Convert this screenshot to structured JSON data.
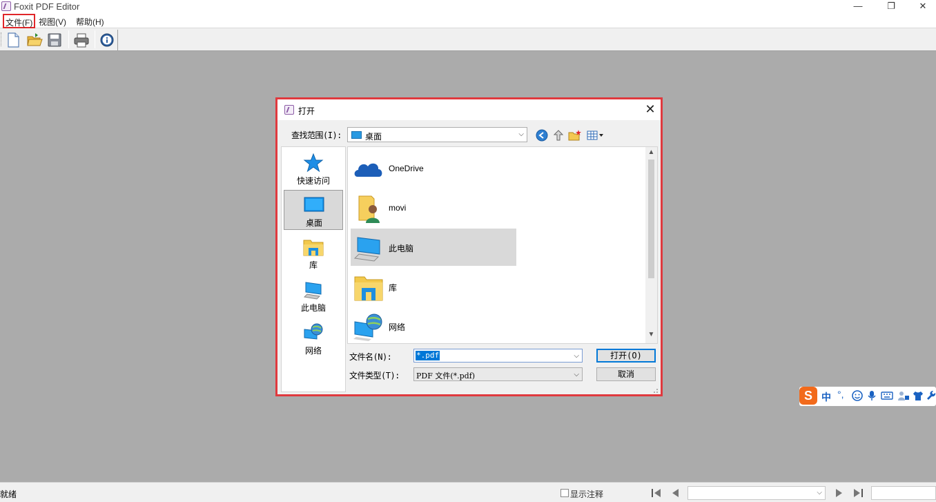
{
  "app": {
    "title": "Foxit PDF Editor",
    "window_buttons": {
      "minimize": "—",
      "restore": "❐",
      "close": "✕"
    }
  },
  "menubar": {
    "items": [
      {
        "label": "文件(F)"
      },
      {
        "label": "视图(V)"
      },
      {
        "label": "帮助(H)"
      }
    ]
  },
  "toolbar": {
    "buttons": [
      "new-document-icon",
      "open-folder-icon",
      "save-icon",
      "print-icon",
      "info-icon"
    ]
  },
  "dialog": {
    "title": "打开",
    "close": "✕",
    "look_in_label": "查找范围(I):",
    "look_in_value": "桌面",
    "places": [
      {
        "label": "快速访问",
        "icon": "quick-access-star-icon"
      },
      {
        "label": "桌面",
        "icon": "desktop-icon",
        "selected": true
      },
      {
        "label": "库",
        "icon": "library-icon"
      },
      {
        "label": "此电脑",
        "icon": "this-pc-icon"
      },
      {
        "label": "网络",
        "icon": "network-icon"
      }
    ],
    "files": [
      {
        "name": "OneDrive",
        "icon": "onedrive-cloud-icon"
      },
      {
        "name": "movi",
        "icon": "user-folder-icon"
      },
      {
        "name": "此电脑",
        "icon": "this-pc-icon",
        "selected": true
      },
      {
        "name": "库",
        "icon": "library-icon"
      },
      {
        "name": "网络",
        "icon": "network-icon"
      }
    ],
    "filename_label": "文件名(N):",
    "filename_value": "*.pdf",
    "filetype_label": "文件类型(T):",
    "filetype_value": "PDF 文件(*.pdf)",
    "open_button": "打开(O)",
    "cancel_button": "取消"
  },
  "statusbar": {
    "status": "就绪",
    "show_annotations_label": "显示注释",
    "show_annotations_checked": false
  },
  "ime": {
    "logo": "S",
    "mode": "中",
    "punct": "°,"
  },
  "colors": {
    "highlight_red": "#e0393e",
    "selection_blue": "#0078d7",
    "workspace_gray": "#ababab"
  }
}
